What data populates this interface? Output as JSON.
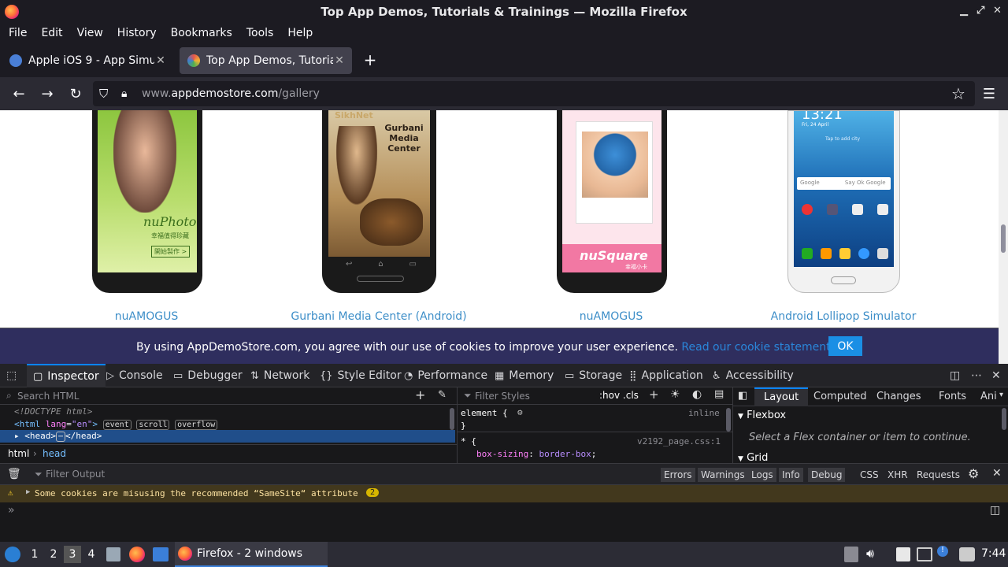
{
  "window": {
    "title": "Top App Demos, Tutorials & Trainings — Mozilla Firefox"
  },
  "menu": [
    "File",
    "Edit",
    "View",
    "History",
    "Bookmarks",
    "Tools",
    "Help"
  ],
  "tabs": [
    {
      "label": "Apple iOS 9 - App Simulator",
      "active": false
    },
    {
      "label": "Top App Demos, Tutorials & Trainings",
      "active": true
    }
  ],
  "new_tab": "+",
  "url": {
    "prefix": "www.",
    "domain": "appdemostore.com",
    "path": "/gallery"
  },
  "apps": [
    {
      "name": "nuAMOGUS",
      "screen_text": "nuPhoto",
      "screen_sub": "幸福值得珍藏",
      "screen_btn": "開始製作 >"
    },
    {
      "name": "Gurbani Media Center (Android)",
      "screen_text": "Gurbani Media Center",
      "screen_top": "SikhNet"
    },
    {
      "name": "nuAMOGUS",
      "screen_text": "nuSquare",
      "screen_sub": "幸福小卡"
    },
    {
      "name": "Android Lollipop Simulator",
      "screen_time": "13:21",
      "screen_date": "Fri, 24 April",
      "screen_hint": "Tap to add city",
      "screen_search": "Google",
      "screen_search_hint": "Say Ok Google"
    }
  ],
  "cookie": {
    "text": "By using AppDemoStore.com, you agree with our use of cookies to improve your user experience.",
    "link": "Read our cookie statement.",
    "ok": "OK"
  },
  "devtools": {
    "tabs": [
      "Inspector",
      "Console",
      "Debugger",
      "Network",
      "Style Editor",
      "Performance",
      "Memory",
      "Storage",
      "Application",
      "Accessibility"
    ],
    "search_html": "Search HTML",
    "html_lines": {
      "doctype": "<!DOCTYPE html>",
      "html_open": "<html ",
      "lang_attr": "lang",
      "lang_val": "\"en\"",
      "close": ">",
      "head_line": "<head>",
      "head_close": "</head>",
      "ellipsis": "⋯"
    },
    "badges": [
      "event",
      "scroll",
      "overflow"
    ],
    "breadcrumb": [
      "html",
      "head"
    ],
    "filter_styles": "Filter Styles",
    "hov_cls": ":hov .cls",
    "rules": {
      "element": "element {",
      "inline": "inline",
      "close": "}",
      "star": "* {",
      "source": "v2192_page.css:1",
      "prop": "box-sizing",
      "value": "border-box"
    },
    "layout_tabs": [
      "Layout",
      "Computed",
      "Changes",
      "Fonts",
      "Ani"
    ],
    "flexbox_title": "Flexbox",
    "flexbox_msg": "Select a Flex container or item to continue.",
    "grid_title": "Grid",
    "filter_output": "Filter Output",
    "levels": [
      "Errors",
      "Warnings",
      "Logs",
      "Info",
      "Debug"
    ],
    "types": [
      "CSS",
      "XHR",
      "Requests"
    ],
    "warning": "Some cookies are misusing the recommended “SameSite“ attribute",
    "warning_count": "2"
  },
  "taskbar": {
    "workspaces": [
      "1",
      "2",
      "3",
      "4"
    ],
    "window_label": "Firefox - 2 windows",
    "clock": "7:44"
  }
}
